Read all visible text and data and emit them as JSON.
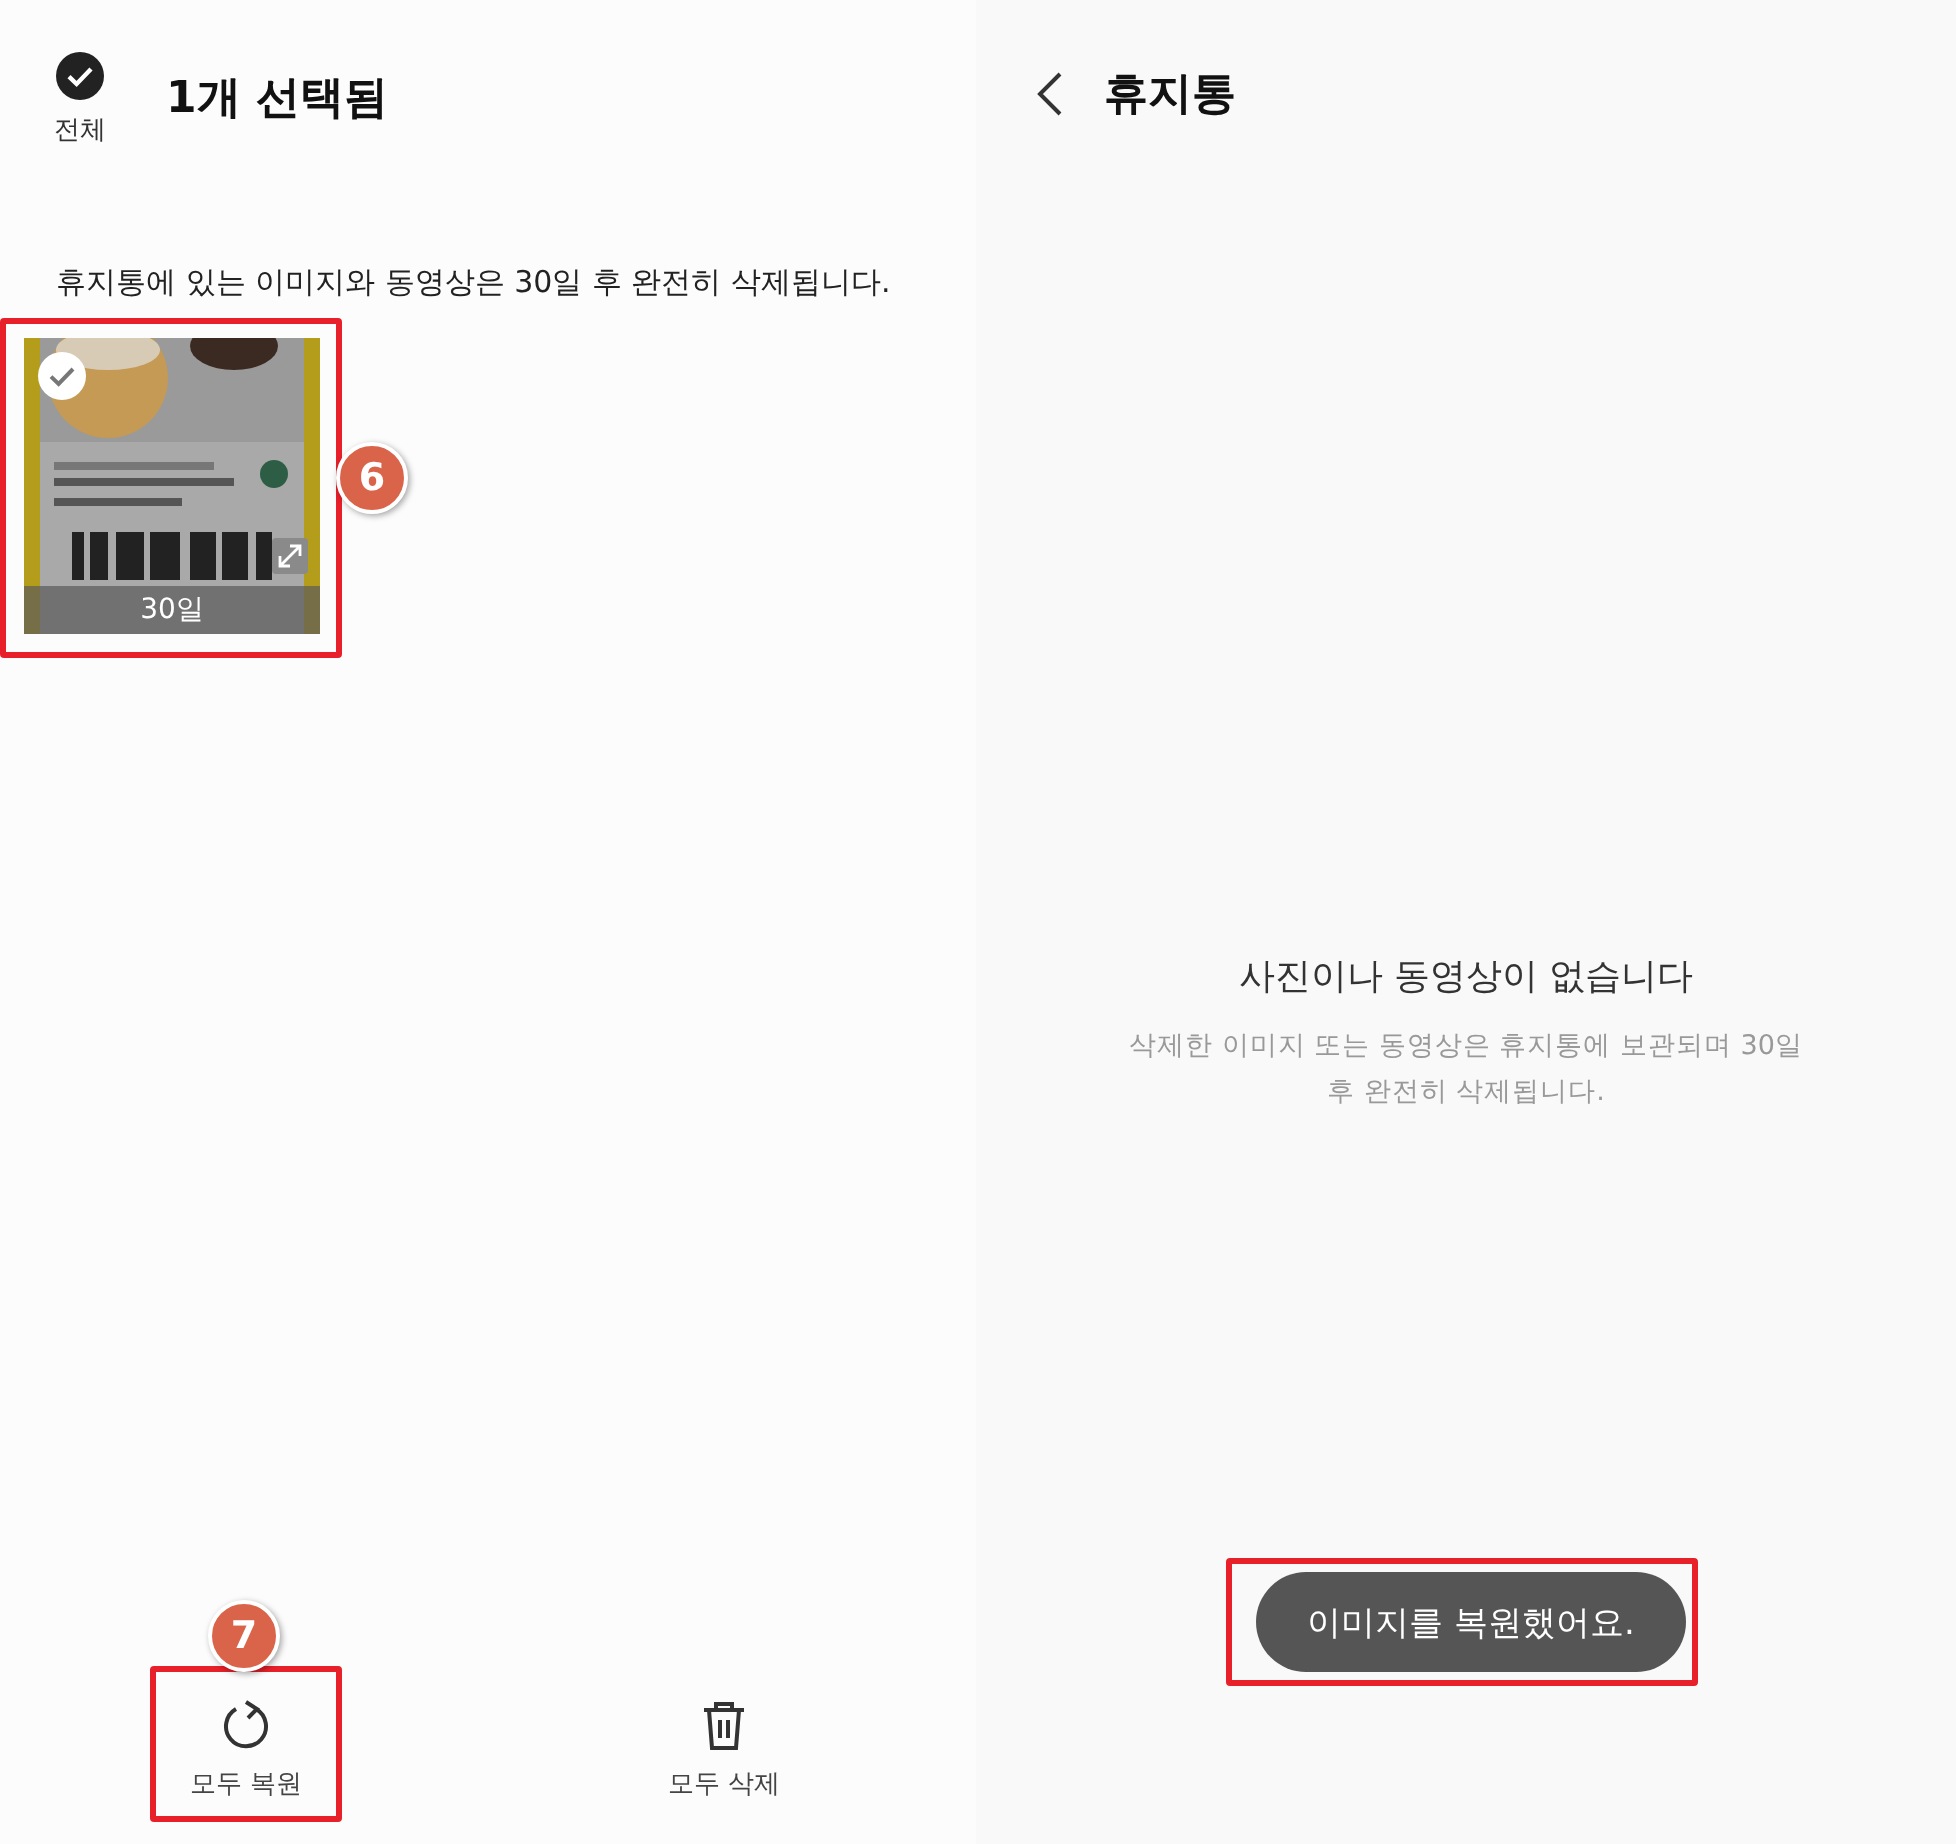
{
  "left_screen": {
    "select_all": {
      "label": "전체",
      "checked": true
    },
    "title": "1개 선택됨",
    "notice": "휴지통에 있는 이미지와 동영상은 30일 후 완전히 삭제됩니다.",
    "items": [
      {
        "kind": "picture",
        "selected": true,
        "days_left": "30일",
        "highlighted": true,
        "callout": "6"
      }
    ],
    "bottom_actions": [
      {
        "kind": "restore",
        "label": "모두 복원",
        "highlighted": true,
        "callout": "7"
      },
      {
        "kind": "trash",
        "label": "모두 삭제",
        "highlighted": false
      }
    ]
  },
  "right_screen": {
    "title": "휴지통",
    "empty_title": "사진이나 동영상이 없습니다",
    "empty_text": "삭제한 이미지 또는 동영상은 휴지통에 보관되며 30일 후 완전히 삭제됩니다.",
    "toast": {
      "text": "이미지를 복원했어요.",
      "highlighted": true
    }
  }
}
